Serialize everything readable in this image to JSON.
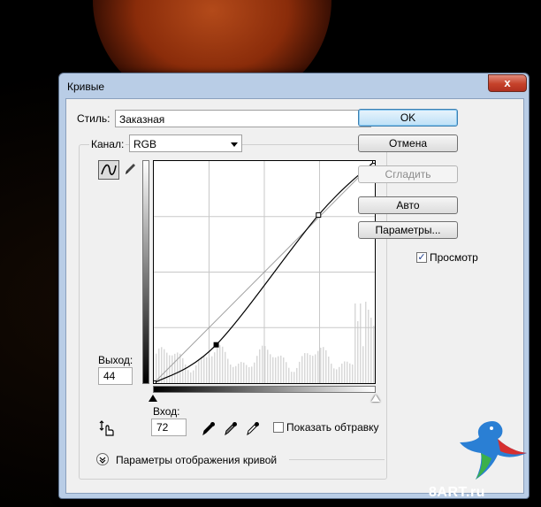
{
  "dialog": {
    "title": "Кривые",
    "close_symbol": "x"
  },
  "style_row": {
    "label": "Стиль:",
    "value": "Заказная"
  },
  "channel_row": {
    "label": "Канал:",
    "value": "RGB"
  },
  "buttons": {
    "ok": "OK",
    "cancel": "Отмена",
    "smooth": "Сгладить",
    "auto": "Авто",
    "options": "Параметры..."
  },
  "preview": {
    "label": "Просмотр",
    "checked": true
  },
  "output": {
    "label": "Выход:",
    "value": "44"
  },
  "input": {
    "label": "Вход:",
    "value": "72"
  },
  "show_clipping": {
    "label": "Показать обтравку",
    "checked": false
  },
  "curve_display_options": {
    "label": "Параметры отображения кривой"
  },
  "curve": {
    "points": [
      [
        0,
        0
      ],
      [
        72,
        44
      ],
      [
        190,
        193
      ],
      [
        255,
        255
      ]
    ]
  },
  "watermark": "8ART.ru",
  "icons": {
    "curve_tool": "curve-icon",
    "pencil": "pencil-icon",
    "preset_menu": "preset-menu-icon",
    "hand_adjust": "hand-adjust-icon",
    "eyedropper_black": "eyedropper-black-icon",
    "eyedropper_gray": "eyedropper-gray-icon",
    "eyedropper_white": "eyedropper-white-icon",
    "expand": "expand-chevron-icon"
  }
}
